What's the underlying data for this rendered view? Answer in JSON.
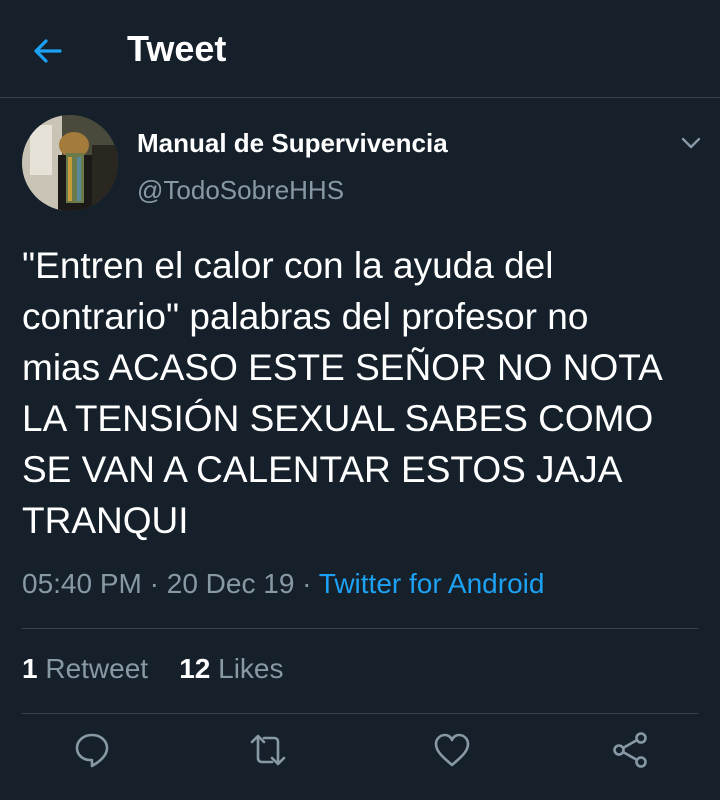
{
  "header": {
    "title": "Tweet",
    "back_icon": "arrow-left-icon"
  },
  "tweet": {
    "author_name": "Manual de Supervivencia",
    "author_handle": "@TodoSobreHHS",
    "more_icon": "chevron-down-icon",
    "text": "\"Entren el calor con la ayuda del\ncontrario\" palabras del profesor no\nmias ACASO ESTE SEÑOR NO NOTA\nLA TENSIÓN SEXUAL SABES COMO\nSE VAN A CALENTAR ESTOS JAJA\nTRANQUI",
    "time": "05:40 PM",
    "separator": " · ",
    "date": "20 Dec 19",
    "source": "Twitter for Android"
  },
  "stats": {
    "retweets_count": "1",
    "retweets_label": "Retweet",
    "likes_count": "12",
    "likes_label": "Likes"
  },
  "actions": {
    "reply_icon": "reply-icon",
    "retweet_icon": "retweet-icon",
    "like_icon": "heart-icon",
    "share_icon": "share-icon"
  },
  "colors": {
    "background": "#15202b",
    "accent": "#1da1f2",
    "secondary_text": "#8899a6",
    "divider": "#38444d"
  }
}
